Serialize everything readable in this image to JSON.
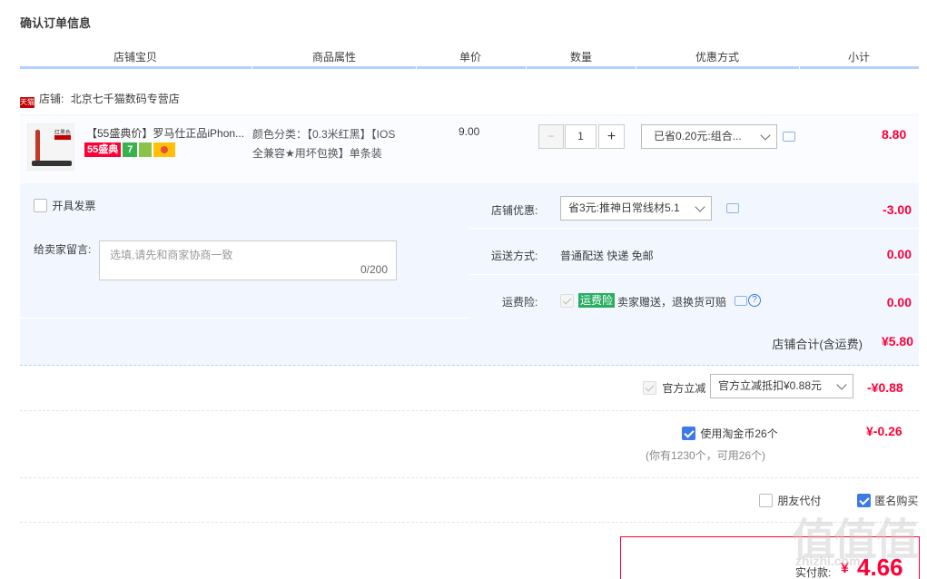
{
  "page_title": "确认订单信息",
  "columns": [
    "店铺宝贝",
    "商品属性",
    "单价",
    "数量",
    "优惠方式",
    "小计"
  ],
  "shop": {
    "badge": "天猫",
    "label": "店铺:",
    "name": "北京七千猫数码专营店"
  },
  "item": {
    "thumb_text": "红黑色",
    "title": "【55盛典价】罗马仕正品iPhon...",
    "tag_55": "55盛典",
    "tag_7": "7",
    "attr_line1": "颜色分类：【0.3米红黑】【IOS",
    "attr_line2": "全兼容★用坏包换】单条装",
    "unit_price": "9.00",
    "qty_minus": "−",
    "qty_value": "1",
    "qty_plus": "+",
    "discount_select": "已省0.20元:组合...",
    "subtotal": "8.80"
  },
  "invoice_label": "开具发票",
  "message": {
    "label": "给卖家留言:",
    "placeholder": "选填,请先和商家协商一致",
    "counter": "0/200"
  },
  "shop_discount": {
    "label": "店铺优惠:",
    "select": "省3元:推神日常线材5.1",
    "amount": "-3.00"
  },
  "shipping": {
    "label": "运送方式:",
    "value": "普通配送 快递 免邮",
    "amount": "0.00"
  },
  "insurance": {
    "label": "运费险:",
    "badge": "运费险",
    "text": "卖家赠送，退换货可赔",
    "help": "?",
    "amount": "0.00"
  },
  "shop_total": {
    "label": "店铺合计(含运费)",
    "amount": "¥5.80"
  },
  "official_discount": {
    "label": "官方立减",
    "select": "官方立减抵扣¥0.88元",
    "amount": "-¥0.88"
  },
  "coins": {
    "label": "使用淘金币26个",
    "note": "(你有1230个，可用26个)",
    "amount": "¥-0.26"
  },
  "friend_pay": "朋友代付",
  "anonymous": "匿名购买",
  "pay": {
    "label": "实付款:",
    "currency": "¥",
    "amount": "4.66"
  },
  "watermark": "值值值",
  "watermark_url": "zhizhi.com",
  "colors": {
    "accent": "#ff0036",
    "panel": "#f2f7ff",
    "header_line": "#b2d1ff",
    "checkbox": "#3d7ae8"
  }
}
